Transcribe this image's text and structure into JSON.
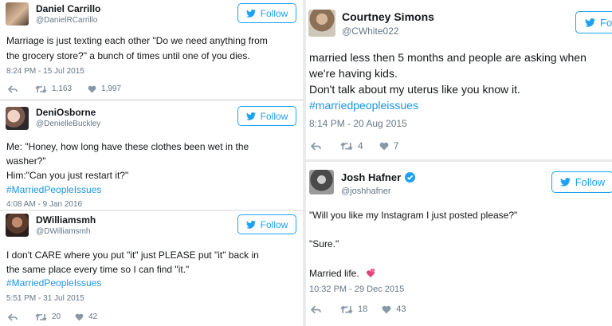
{
  "tweets": [
    {
      "name": "Daniel Carrillo",
      "handle": "@DanielRCarrillo",
      "follow_label": "Follow",
      "lines": [
        "Marriage is just texting each other \"Do we need anything from",
        "the grocery store?\" a bunch of times until one of you dies."
      ],
      "time": "8:24 PM - 15 Jul 2015",
      "retweets": "1,163",
      "likes": "1,997"
    },
    {
      "name": "DeniOsborne",
      "handle": "@DenielleBuckley",
      "follow_label": "Follow",
      "lines": [
        "Me: \"Honey, how long have these clothes been wet in the",
        "washer?\"",
        "Him:\"Can you just restart it?\""
      ],
      "hashtag": "#MarriedPeopleIssues",
      "time": "4:08 AM - 9 Jan 2016"
    },
    {
      "name": "DWilliamsmh",
      "handle": "@DWilliamsmh",
      "follow_label": "Follow",
      "lines": [
        "I don't CARE where you put \"it\" just PLEASE put \"it\" back in",
        "the same place every time so I can find \"it.\""
      ],
      "hashtag": "#MarriedPeopleIssues",
      "time": "5:51 PM - 31 Jul 2015",
      "retweets": "20",
      "likes": "42"
    },
    {
      "name": "Courtney Simons",
      "handle": "@CWhite022",
      "follow_label": "Fo",
      "lines": [
        "married less then 5 months and people are asking when",
        "we're having kids.",
        "Don't talk about my uterus like you know it."
      ],
      "hashtag": "#marriedpeopleissues",
      "time": "8:14 PM - 20 Aug 2015",
      "retweets": "4",
      "likes": "7"
    },
    {
      "name": "Josh Hafner",
      "handle": "@joshhafner",
      "follow_label": "Follow",
      "lines": [
        "\"Will you like my Instagram I just posted please?\"",
        "\"Sure.\"",
        "Married life."
      ],
      "time": "10:32 PM - 29 Dec 2015",
      "retweets": "18",
      "likes": "43"
    }
  ],
  "colors": {
    "accent": "#1da1f2",
    "hashtag": "#1b95e0",
    "meta": "#657786",
    "heart_emoji": "#e0457b",
    "verified": "#1da1f2"
  }
}
